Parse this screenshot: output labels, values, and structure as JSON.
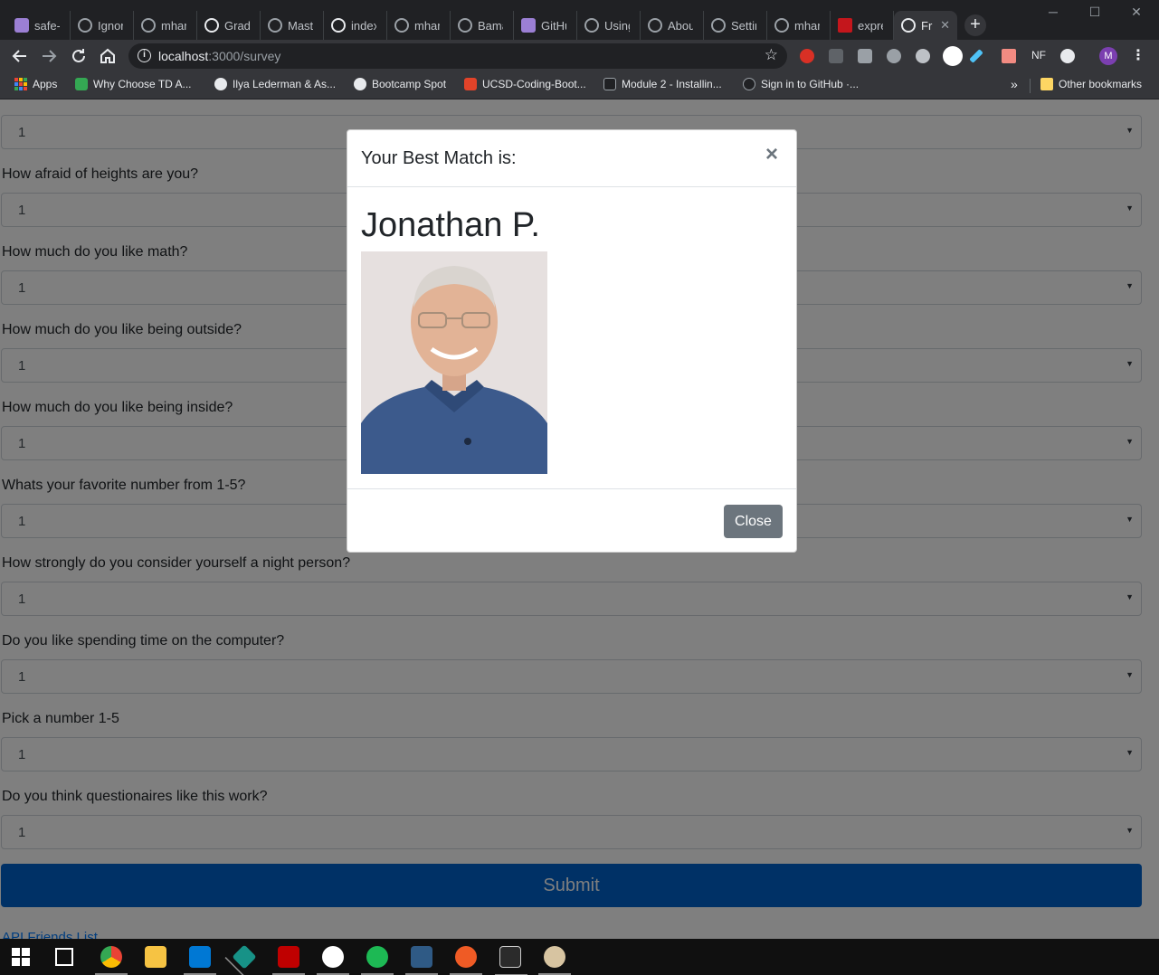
{
  "browser": {
    "tabs": [
      {
        "title": "safe-",
        "icon": "heroku-icon"
      },
      {
        "title": "Ignor",
        "icon": "github-icon"
      },
      {
        "title": "mhan",
        "icon": "github-icon"
      },
      {
        "title": "Grade",
        "icon": "globe-icon"
      },
      {
        "title": "Maste",
        "icon": "github-icon"
      },
      {
        "title": "index",
        "icon": "globe-icon"
      },
      {
        "title": "mhan",
        "icon": "github-icon"
      },
      {
        "title": "Bama",
        "icon": "github-icon"
      },
      {
        "title": "GitHu",
        "icon": "heroku-icon"
      },
      {
        "title": "Using",
        "icon": "github-icon"
      },
      {
        "title": "Abou",
        "icon": "github-icon"
      },
      {
        "title": "Settir",
        "icon": "github-icon"
      },
      {
        "title": "mhan",
        "icon": "github-icon"
      },
      {
        "title": "expre",
        "icon": "npm-icon"
      },
      {
        "title": "Fr",
        "icon": "globe-icon",
        "active": true
      }
    ],
    "new_tab": "+",
    "window_controls": {
      "minimize": "─",
      "maximize": "☐",
      "close": "✕"
    },
    "url_host": "localhost",
    "url_path": ":3000/survey",
    "extension_nf": "NF",
    "profile_initial": "M",
    "bookmarks": [
      {
        "label": "Apps",
        "icon": "apps-grid-icon"
      },
      {
        "label": "Why Choose TD A...",
        "icon": "td-icon"
      },
      {
        "label": "Ilya Lederman & As...",
        "icon": "bird-icon"
      },
      {
        "label": "Bootcamp Spot",
        "icon": "bootcamp-icon"
      },
      {
        "label": "UCSD-Coding-Boot...",
        "icon": "gitlab-icon"
      },
      {
        "label": "Module 2 - Installin...",
        "icon": "book-icon"
      },
      {
        "label": "Sign in to GitHub ·...",
        "icon": "github-icon"
      }
    ],
    "bookmarks_overflow": "»",
    "other_bookmarks": "Other bookmarks"
  },
  "survey": {
    "questions": [
      {
        "label": "",
        "value": "1"
      },
      {
        "label": "How afraid of heights are you?",
        "value": "1"
      },
      {
        "label": "How much do you like math?",
        "value": "1"
      },
      {
        "label": "How much do you like being outside?",
        "value": "1"
      },
      {
        "label": "How much do you like being inside?",
        "value": "1"
      },
      {
        "label": "Whats your favorite number from 1-5?",
        "value": "1"
      },
      {
        "label": "How strongly do you consider yourself a night person?",
        "value": "1"
      },
      {
        "label": "Do you like spending time on the computer?",
        "value": "1"
      },
      {
        "label": "Pick a number 1-5",
        "value": "1"
      },
      {
        "label": "Do you think questionaires like this work?",
        "value": "1"
      }
    ],
    "submit_label": "Submit",
    "footer_link": "API Friends List"
  },
  "modal": {
    "title": "Your Best Match is:",
    "close_x": "×",
    "match_name": "Jonathan P.",
    "close_label": "Close"
  },
  "colors": {
    "primary": "#0062cc",
    "secondary": "#6c757d"
  },
  "taskbar": {
    "items": [
      "windows-start-icon",
      "task-view-icon",
      "chrome-icon",
      "file-explorer-icon",
      "vscode-icon",
      "git-kraken-icon",
      "filezilla-icon",
      "slack-icon",
      "spotify-icon",
      "mysql-workbench-icon",
      "postman-icon",
      "terminal-icon",
      "paint-icon"
    ]
  }
}
